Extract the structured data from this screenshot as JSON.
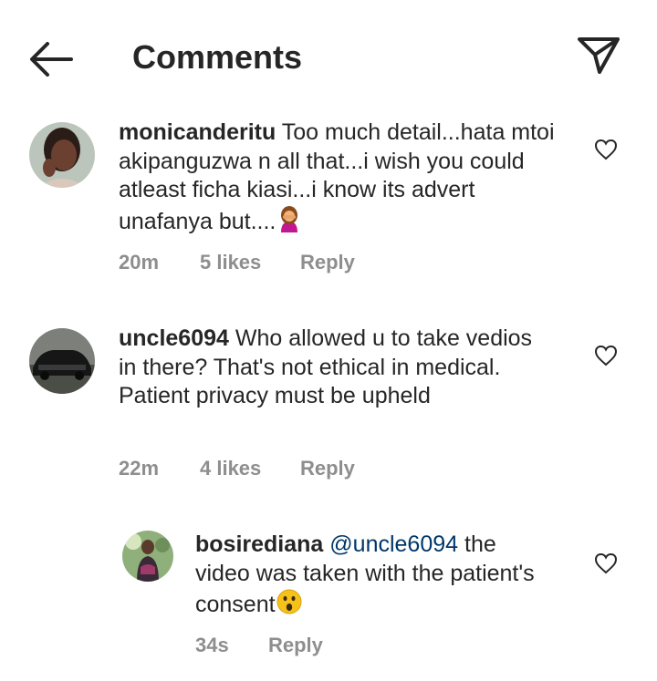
{
  "header": {
    "title": "Comments",
    "back_icon": "arrow-left-icon",
    "share_icon": "paper-plane-icon"
  },
  "colors": {
    "text": "#262626",
    "meta": "#8e8e8e",
    "mention": "#00376b"
  },
  "comments": [
    {
      "username": "monicanderitu",
      "text": "Too much detail...hata mtoi akipanguzwa n all that...i wish you could atleast ficha kiasi...i know its advert unafanya but....",
      "emoji": "woman-facepalming",
      "time": "20m",
      "likes": "5 likes",
      "reply": "Reply"
    },
    {
      "username": "uncle6094",
      "text": "Who allowed u to take vedios in there? That's not ethical in medical. Patient privacy must be upheld",
      "time": "22m",
      "likes": "4 likes",
      "reply": "Reply",
      "replies": [
        {
          "username": "bosirediana",
          "mention": "@uncle6094",
          "text": "the video was taken with the patient's consent",
          "emoji": "astonished-face",
          "time": "34s",
          "reply": "Reply"
        }
      ]
    }
  ]
}
